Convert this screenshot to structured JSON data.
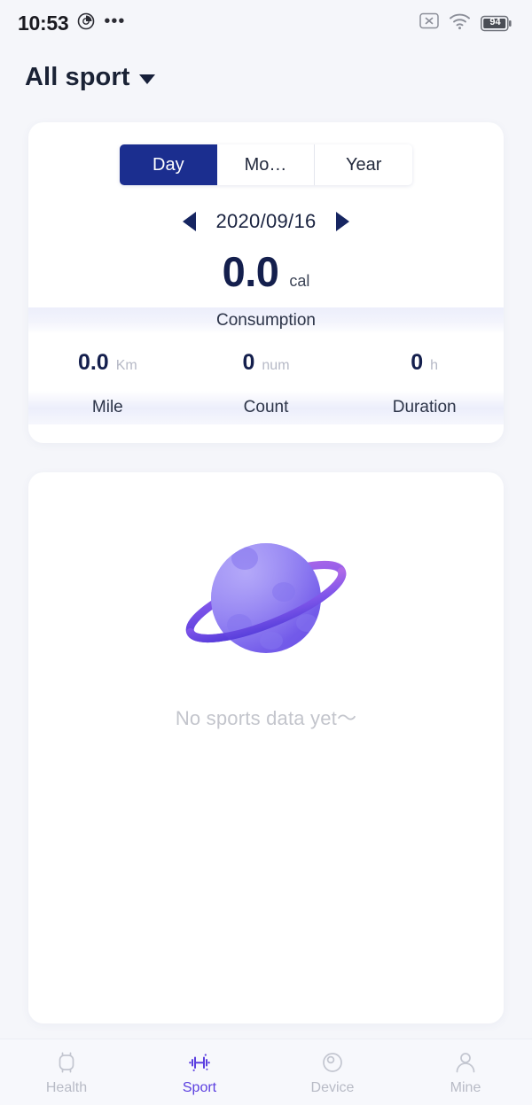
{
  "status_bar": {
    "time": "10:53",
    "overflow_dots": "•••",
    "record_icon": "screen-record-icon",
    "close_icon": "x-box-icon",
    "wifi_icon": "wifi-icon",
    "battery_level": "94"
  },
  "header": {
    "title": "All sport",
    "dropdown_icon": "caret-down-icon"
  },
  "stats_card": {
    "tabs": [
      {
        "label": "Day",
        "active": true
      },
      {
        "label": "Mo…",
        "active": false
      },
      {
        "label": "Year",
        "active": false
      }
    ],
    "date": "2020/09/16",
    "prev_icon": "triangle-left-icon",
    "next_icon": "triangle-right-icon",
    "primary": {
      "value": "0.0",
      "unit": "cal",
      "label": "Consumption"
    },
    "metrics": [
      {
        "value": "0.0",
        "unit": "Km",
        "label": "Mile"
      },
      {
        "value": "0",
        "unit": "num",
        "label": "Count"
      },
      {
        "value": "0",
        "unit": "h",
        "label": "Duration"
      }
    ]
  },
  "empty_state": {
    "illustration": "planet-with-ring-icon",
    "message": "No sports data yet〜"
  },
  "bottom_nav": [
    {
      "label": "Health",
      "icon": "smartwatch-icon",
      "active": false
    },
    {
      "label": "Sport",
      "icon": "dumbbell-icon",
      "active": true
    },
    {
      "label": "Device",
      "icon": "watch-face-circle-icon",
      "active": false
    },
    {
      "label": "Mine",
      "icon": "person-icon",
      "active": false
    }
  ],
  "colors": {
    "accent_navy": "#1b2e8f",
    "accent_purple": "#5b3fe0",
    "text_dark": "#141f4d",
    "text_muted": "#b8bbc6",
    "page_bg": "#f5f6fa"
  }
}
